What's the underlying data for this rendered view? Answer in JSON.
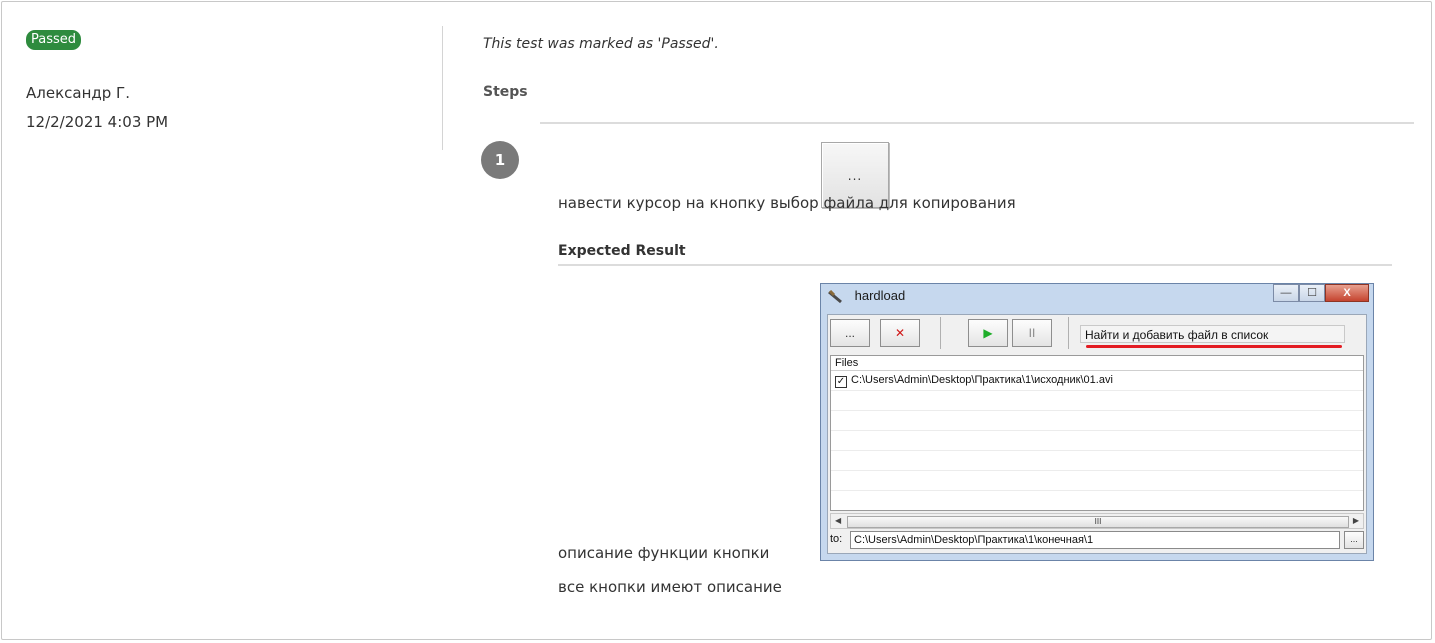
{
  "result": {
    "status_label": "Passed",
    "author": "Александр Г.",
    "datetime": "12/2/2021 4:03 PM",
    "note": "This test was marked as 'Passed'.",
    "status_color": "#2e8b3e"
  },
  "steps": {
    "heading": "Steps",
    "items": [
      {
        "number": "1",
        "action": "навести курсор на кнопку выбор файла для копирования",
        "button_image_label": "...",
        "expected_heading": "Expected Result",
        "expected_lines": [
          "описание функции кнопки",
          "все кнопки имеют описание"
        ]
      }
    ]
  },
  "screenshot": {
    "window_title": "hardload",
    "toolbar": {
      "browse_label": "...",
      "remove_label": "✕",
      "play_label": "▶",
      "pause_label": "II"
    },
    "hint_text": "Найти и добавить файл в список",
    "files_header": "Files",
    "files": [
      {
        "checked": "✓",
        "path": "C:\\Users\\Admin\\Desktop\\Практика\\1\\исходник\\01.avi"
      }
    ],
    "scroll_grip": "III",
    "to_label": "to:",
    "to_value": "C:\\Users\\Admin\\Desktop\\Практика\\1\\конечная\\1",
    "to_browse_label": "...",
    "window_controls": {
      "minimize": "—",
      "maximize": "☐",
      "close": "X"
    }
  }
}
